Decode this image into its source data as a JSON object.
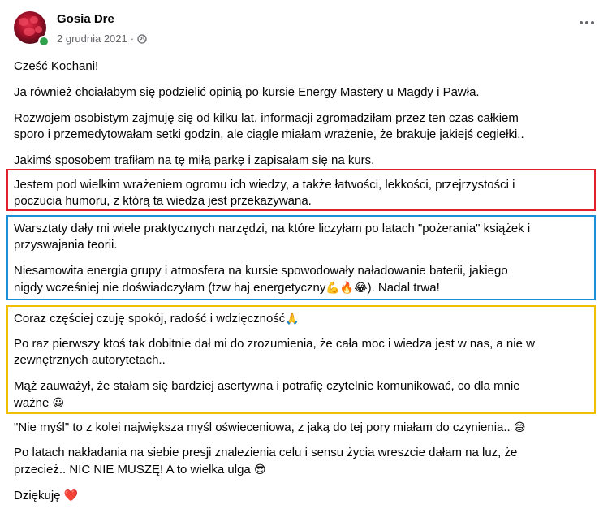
{
  "post": {
    "author": "Gosia Dre",
    "date": "2 grudnia 2021",
    "separator": "·",
    "paragraphs": {
      "p1": "Cześć Kochani!",
      "p2": "Ja również chciałabym się podzielić opinią po kursie Energy Mastery u Magdy i Pawła.",
      "p3a": "Rozwojem osobistym zajmuję się od kilku lat, informacji zgromadziłam przez ten czas całkiem",
      "p3b": "sporo i przemedytowałam setki godzin, ale ciągle miałam wrażenie, że brakuje jakiejś cegiełki..",
      "p4": "Jakimś sposobem trafiłam na tę miłą parkę i zapisałam się na kurs.",
      "p5a": "Jestem pod wielkim wrażeniem ogromu ich wiedzy, a także łatwości, lekkości, przejrzystości i",
      "p5b": "poczucia humoru, z którą ta wiedza jest przekazywana.",
      "p6a": "Warsztaty dały mi wiele praktycznych narzędzi, na które liczyłam po latach \"pożerania\" książek i",
      "p6b": "przyswajania teorii.",
      "p7a": "Niesamowita energia grupy i atmosfera na kursie spowodowały naładowanie baterii, jakiego",
      "p7b": "nigdy wcześniej nie doświadczyłam (tzw haj energetyczny",
      "p7emoji": "💪🔥😂",
      "p7c": "). Nadal trwa!",
      "p8": "Coraz częściej czuję spokój, radość i wdzięczność",
      "p8emoji": "🙏",
      "p9a": "Po raz pierwszy ktoś tak dobitnie dał mi do zrozumienia, że cała moc i wiedza jest w nas, a nie w",
      "p9b": "zewnętrznych autorytetach..",
      "p10a": "Mąż zauważył, że stałam się bardziej asertywna i potrafię czytelnie komunikować, co dla mnie",
      "p10b": "ważne",
      "p10emoji": "😀",
      "p11": "\"Nie myśl\" to z kolei największa myśl oświeceniowa, z jaką do tej pory miałam do czynienia..",
      "p11emoji": "😅",
      "p12a": "Po latach nakładania na siebie presji znalezienia celu i sensu życia wreszcie dałam na luz, że",
      "p12b": "przecież.. NIC NIE MUSZĘ! A to wielka ulga",
      "p12emoji": "😎",
      "p13": "Dziękuję",
      "p13emoji": "❤️"
    }
  },
  "icons": {
    "audience": "globe-icon",
    "menu": "more-options-icon"
  },
  "colors": {
    "highlight_red": "#e0202c",
    "highlight_blue": "#1a8fd8",
    "highlight_yellow": "#f0c000",
    "online": "#31a24c"
  }
}
